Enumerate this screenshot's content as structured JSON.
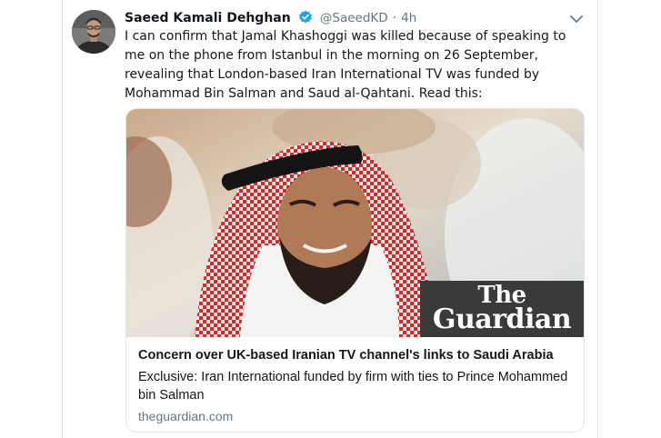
{
  "tweet": {
    "author_name": "Saeed Kamali Dehghan",
    "handle": "@SaeedKD",
    "separator": "·",
    "time": "4h",
    "text": "I can confirm that Jamal Khashoggi was killed because of speaking to me on the phone from Istanbul in the morning on 26 September, revealing that London-based Iran International TV was funded by Mohammad Bin Salman and Saud al-Qahtani. Read this:"
  },
  "card": {
    "logo_line1": "The",
    "logo_line2": "Guardian",
    "title": "Concern over UK-based Iranian TV channel's links to Saudi Arabia",
    "description": "Exclusive: Iran International funded by firm with ties to Prince Mohammed bin Salman",
    "domain": "theguardian.com"
  },
  "colors": {
    "verified_badge": "#1da1f2",
    "secondary_text": "#657786",
    "primary_text": "#14171a",
    "logo_background": "#3a3a3c"
  },
  "icons": {
    "verified": "verified-badge-icon",
    "menu": "chevron-down-icon"
  }
}
